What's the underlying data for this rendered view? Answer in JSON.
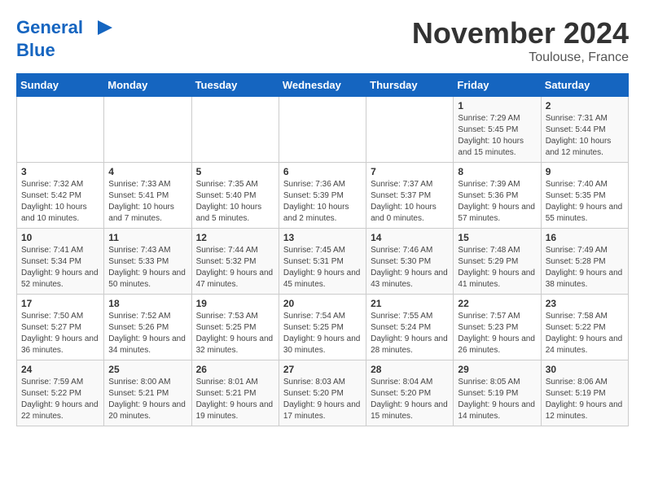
{
  "logo": {
    "line1": "General",
    "line2": "Blue"
  },
  "title": "November 2024",
  "subtitle": "Toulouse, France",
  "weekdays": [
    "Sunday",
    "Monday",
    "Tuesday",
    "Wednesday",
    "Thursday",
    "Friday",
    "Saturday"
  ],
  "weeks": [
    [
      {
        "day": "",
        "info": ""
      },
      {
        "day": "",
        "info": ""
      },
      {
        "day": "",
        "info": ""
      },
      {
        "day": "",
        "info": ""
      },
      {
        "day": "",
        "info": ""
      },
      {
        "day": "1",
        "info": "Sunrise: 7:29 AM\nSunset: 5:45 PM\nDaylight: 10 hours and 15 minutes."
      },
      {
        "day": "2",
        "info": "Sunrise: 7:31 AM\nSunset: 5:44 PM\nDaylight: 10 hours and 12 minutes."
      }
    ],
    [
      {
        "day": "3",
        "info": "Sunrise: 7:32 AM\nSunset: 5:42 PM\nDaylight: 10 hours and 10 minutes."
      },
      {
        "day": "4",
        "info": "Sunrise: 7:33 AM\nSunset: 5:41 PM\nDaylight: 10 hours and 7 minutes."
      },
      {
        "day": "5",
        "info": "Sunrise: 7:35 AM\nSunset: 5:40 PM\nDaylight: 10 hours and 5 minutes."
      },
      {
        "day": "6",
        "info": "Sunrise: 7:36 AM\nSunset: 5:39 PM\nDaylight: 10 hours and 2 minutes."
      },
      {
        "day": "7",
        "info": "Sunrise: 7:37 AM\nSunset: 5:37 PM\nDaylight: 10 hours and 0 minutes."
      },
      {
        "day": "8",
        "info": "Sunrise: 7:39 AM\nSunset: 5:36 PM\nDaylight: 9 hours and 57 minutes."
      },
      {
        "day": "9",
        "info": "Sunrise: 7:40 AM\nSunset: 5:35 PM\nDaylight: 9 hours and 55 minutes."
      }
    ],
    [
      {
        "day": "10",
        "info": "Sunrise: 7:41 AM\nSunset: 5:34 PM\nDaylight: 9 hours and 52 minutes."
      },
      {
        "day": "11",
        "info": "Sunrise: 7:43 AM\nSunset: 5:33 PM\nDaylight: 9 hours and 50 minutes."
      },
      {
        "day": "12",
        "info": "Sunrise: 7:44 AM\nSunset: 5:32 PM\nDaylight: 9 hours and 47 minutes."
      },
      {
        "day": "13",
        "info": "Sunrise: 7:45 AM\nSunset: 5:31 PM\nDaylight: 9 hours and 45 minutes."
      },
      {
        "day": "14",
        "info": "Sunrise: 7:46 AM\nSunset: 5:30 PM\nDaylight: 9 hours and 43 minutes."
      },
      {
        "day": "15",
        "info": "Sunrise: 7:48 AM\nSunset: 5:29 PM\nDaylight: 9 hours and 41 minutes."
      },
      {
        "day": "16",
        "info": "Sunrise: 7:49 AM\nSunset: 5:28 PM\nDaylight: 9 hours and 38 minutes."
      }
    ],
    [
      {
        "day": "17",
        "info": "Sunrise: 7:50 AM\nSunset: 5:27 PM\nDaylight: 9 hours and 36 minutes."
      },
      {
        "day": "18",
        "info": "Sunrise: 7:52 AM\nSunset: 5:26 PM\nDaylight: 9 hours and 34 minutes."
      },
      {
        "day": "19",
        "info": "Sunrise: 7:53 AM\nSunset: 5:25 PM\nDaylight: 9 hours and 32 minutes."
      },
      {
        "day": "20",
        "info": "Sunrise: 7:54 AM\nSunset: 5:25 PM\nDaylight: 9 hours and 30 minutes."
      },
      {
        "day": "21",
        "info": "Sunrise: 7:55 AM\nSunset: 5:24 PM\nDaylight: 9 hours and 28 minutes."
      },
      {
        "day": "22",
        "info": "Sunrise: 7:57 AM\nSunset: 5:23 PM\nDaylight: 9 hours and 26 minutes."
      },
      {
        "day": "23",
        "info": "Sunrise: 7:58 AM\nSunset: 5:22 PM\nDaylight: 9 hours and 24 minutes."
      }
    ],
    [
      {
        "day": "24",
        "info": "Sunrise: 7:59 AM\nSunset: 5:22 PM\nDaylight: 9 hours and 22 minutes."
      },
      {
        "day": "25",
        "info": "Sunrise: 8:00 AM\nSunset: 5:21 PM\nDaylight: 9 hours and 20 minutes."
      },
      {
        "day": "26",
        "info": "Sunrise: 8:01 AM\nSunset: 5:21 PM\nDaylight: 9 hours and 19 minutes."
      },
      {
        "day": "27",
        "info": "Sunrise: 8:03 AM\nSunset: 5:20 PM\nDaylight: 9 hours and 17 minutes."
      },
      {
        "day": "28",
        "info": "Sunrise: 8:04 AM\nSunset: 5:20 PM\nDaylight: 9 hours and 15 minutes."
      },
      {
        "day": "29",
        "info": "Sunrise: 8:05 AM\nSunset: 5:19 PM\nDaylight: 9 hours and 14 minutes."
      },
      {
        "day": "30",
        "info": "Sunrise: 8:06 AM\nSunset: 5:19 PM\nDaylight: 9 hours and 12 minutes."
      }
    ]
  ]
}
